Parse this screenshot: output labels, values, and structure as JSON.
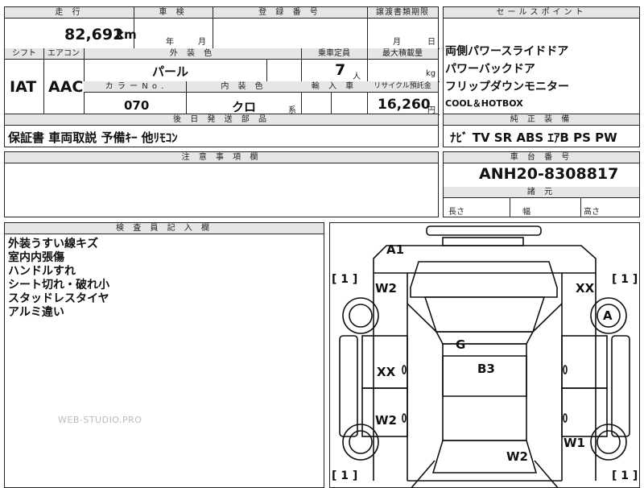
{
  "top": {
    "mileage_label": "走 行",
    "mileage_value": "82,692",
    "mileage_unit": "km",
    "shaken_label": "車 検",
    "shaken_year": "年",
    "shaken_month": "月",
    "reg_label": "登 録 番 号",
    "transfer_label": "譲渡書類期限",
    "transfer_month": "月",
    "transfer_day": "日",
    "shift_label": "シフト",
    "aircon_label": "エアコン",
    "shift_value": "IAT",
    "aircon_value": "AAC",
    "color_label": "外 装 色",
    "color_value": "パール",
    "capacity_label": "乗車定員",
    "capacity_value": "7",
    "capacity_unit": "人",
    "maxload_label": "最大積載量",
    "maxload_unit": "kg",
    "colorno_label": "カ ラ ー  N o .",
    "colorno_value": "070",
    "interior_label": "内 装 色",
    "interior_value": "クロ",
    "interior_suffix": "系",
    "import_label": "輸 入 車",
    "recycle_label": "リサイクル預託金",
    "recycle_value": "16,260",
    "recycle_unit": "円",
    "parts_label": "後 日 発 送 部 品",
    "parts_value": "保証書  車両取説  予備ｷｰ  他ﾘﾓｺﾝ"
  },
  "sales": {
    "label": "セールスポイント",
    "points": [
      "両側パワースライドドア",
      "パワーバックドア",
      "フリップダウンモニター",
      "COOL＆HOTBOX"
    ]
  },
  "equipment": {
    "label": "純 正 装 備",
    "value": "ﾅﾋﾞ  TV  SR  ABS  ｴｱB  PS  PW"
  },
  "notes": {
    "label": "注 意 事 項 欄"
  },
  "chassis": {
    "label": "車 台 番 号",
    "value": "ANH20-8308817",
    "dims_label": "諸 元",
    "length": "長さ",
    "width": "幅",
    "height": "高さ"
  },
  "inspector": {
    "label": "検 査 員 記 入 欄",
    "items": [
      "外装うすい線キズ",
      "室内内張傷",
      "ハンドルすれ",
      "シート切れ・破れ小",
      "スタッドレスタイヤ",
      "アルミ違い"
    ],
    "watermark": "WEB-STUDIO.PRO"
  },
  "diagram": {
    "marks": {
      "a1": "A1",
      "w2_front_left": "W2",
      "xx_front_right": "XX",
      "a_wheel_right": "A",
      "g_roof": "G",
      "b3_center": "B3",
      "xx_left": "XX",
      "w2_left": "W2",
      "w1_right": "W1",
      "w2_rear": "W2"
    },
    "tire_left_top": "1",
    "tire_right_top": "1",
    "tire_left_bottom": "1",
    "tire_right_bottom": "1"
  }
}
